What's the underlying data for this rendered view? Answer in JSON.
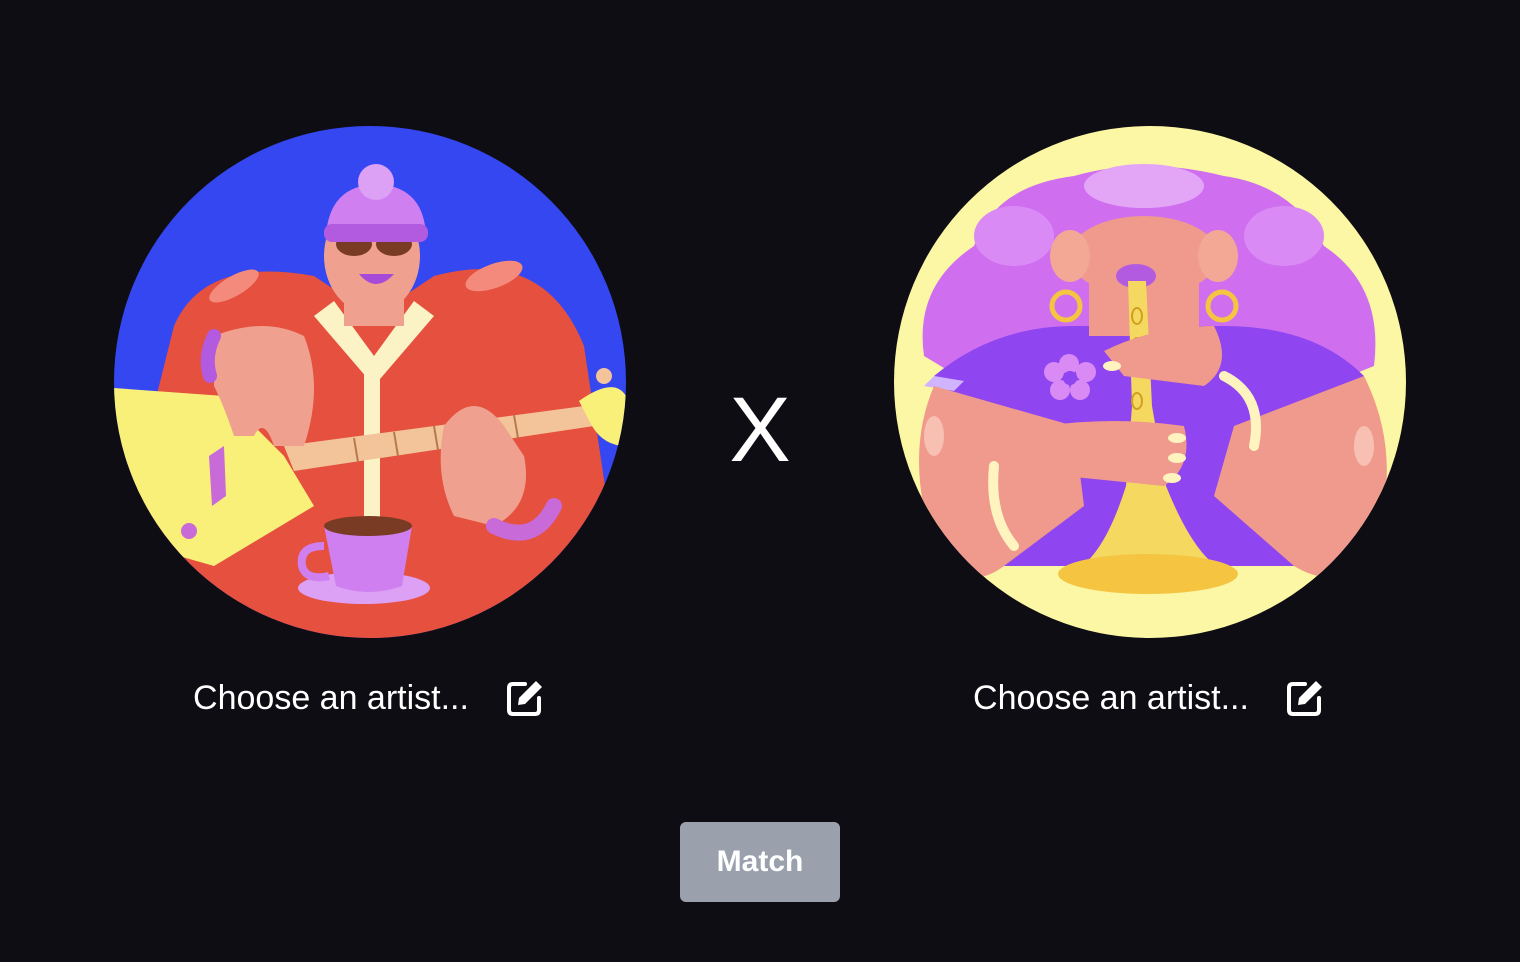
{
  "left_artist": {
    "placeholder": "Choose an artist...",
    "avatar_icon": "guitar-player-illustration",
    "avatar_bg": "#3547f0",
    "edit_icon": "edit-icon"
  },
  "versus": {
    "symbol": "X"
  },
  "right_artist": {
    "placeholder": "Choose an artist...",
    "avatar_icon": "trumpet-player-illustration",
    "avatar_bg": "#fcf7a4",
    "edit_icon": "edit-icon"
  },
  "match_button": {
    "label": "Match",
    "color": "#9aa1ad"
  },
  "colors": {
    "background": "#0f0d14",
    "text": "#ffffff"
  }
}
